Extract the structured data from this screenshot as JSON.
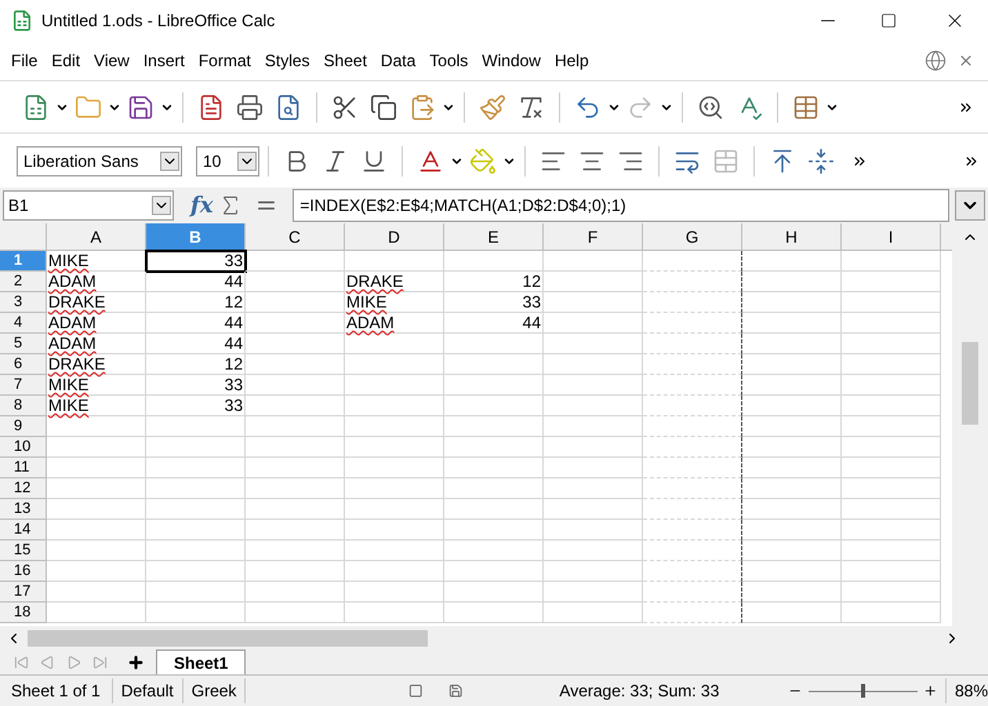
{
  "window": {
    "title": "Untitled 1.ods - LibreOffice Calc"
  },
  "menu": [
    "File",
    "Edit",
    "View",
    "Insert",
    "Format",
    "Styles",
    "Sheet",
    "Data",
    "Tools",
    "Window",
    "Help"
  ],
  "format_bar": {
    "font_name": "Liberation Sans",
    "font_size": "10"
  },
  "formula_bar": {
    "name_box": "B1",
    "function_wizard": "fx",
    "formula": "=INDEX(E$2:E$4;MATCH(A1;D$2:D$4;0);1)"
  },
  "columns": [
    {
      "label": "A",
      "selected": false
    },
    {
      "label": "B",
      "selected": true
    },
    {
      "label": "C",
      "selected": false
    },
    {
      "label": "D",
      "selected": false
    },
    {
      "label": "E",
      "selected": false
    },
    {
      "label": "F",
      "selected": false
    },
    {
      "label": "G",
      "selected": false
    },
    {
      "label": "H",
      "selected": false
    },
    {
      "label": "I",
      "selected": false
    }
  ],
  "rows": [
    {
      "number": "1",
      "selected": true,
      "cells": [
        {
          "text": "MIKE",
          "kind": "text",
          "misspelled": true
        },
        {
          "text": "33",
          "kind": "number",
          "selected": true
        },
        {},
        {},
        {},
        {},
        {},
        {},
        {}
      ]
    },
    {
      "number": "2",
      "selected": false,
      "cells": [
        {
          "text": "ADAM",
          "kind": "text",
          "misspelled": true
        },
        {
          "text": "44",
          "kind": "number"
        },
        {},
        {
          "text": "DRAKE",
          "kind": "text",
          "misspelled": true
        },
        {
          "text": "12",
          "kind": "number"
        },
        {},
        {},
        {},
        {}
      ]
    },
    {
      "number": "3",
      "selected": false,
      "cells": [
        {
          "text": "DRAKE",
          "kind": "text",
          "misspelled": true
        },
        {
          "text": "12",
          "kind": "number"
        },
        {},
        {
          "text": "MIKE",
          "kind": "text",
          "misspelled": true
        },
        {
          "text": "33",
          "kind": "number"
        },
        {},
        {},
        {},
        {}
      ]
    },
    {
      "number": "4",
      "selected": false,
      "cells": [
        {
          "text": "ADAM",
          "kind": "text",
          "misspelled": true
        },
        {
          "text": "44",
          "kind": "number"
        },
        {},
        {
          "text": "ADAM",
          "kind": "text",
          "misspelled": true
        },
        {
          "text": "44",
          "kind": "number"
        },
        {},
        {},
        {},
        {}
      ]
    },
    {
      "number": "5",
      "selected": false,
      "cells": [
        {
          "text": "ADAM",
          "kind": "text",
          "misspelled": true
        },
        {
          "text": "44",
          "kind": "number"
        },
        {},
        {},
        {},
        {},
        {},
        {},
        {}
      ]
    },
    {
      "number": "6",
      "selected": false,
      "cells": [
        {
          "text": "DRAKE",
          "kind": "text",
          "misspelled": true
        },
        {
          "text": "12",
          "kind": "number"
        },
        {},
        {},
        {},
        {},
        {},
        {},
        {}
      ]
    },
    {
      "number": "7",
      "selected": false,
      "cells": [
        {
          "text": "MIKE",
          "kind": "text",
          "misspelled": true
        },
        {
          "text": "33",
          "kind": "number"
        },
        {},
        {},
        {},
        {},
        {},
        {},
        {}
      ]
    },
    {
      "number": "8",
      "selected": false,
      "cells": [
        {
          "text": "MIKE",
          "kind": "text",
          "misspelled": true
        },
        {
          "text": "33",
          "kind": "number"
        },
        {},
        {},
        {},
        {},
        {},
        {},
        {}
      ]
    },
    {
      "number": "9",
      "selected": false
    },
    {
      "number": "10",
      "selected": false
    },
    {
      "number": "11",
      "selected": false
    },
    {
      "number": "12",
      "selected": false
    },
    {
      "number": "13",
      "selected": false
    },
    {
      "number": "14",
      "selected": false
    },
    {
      "number": "15",
      "selected": false
    },
    {
      "number": "16",
      "selected": false
    },
    {
      "number": "17",
      "selected": false
    },
    {
      "number": "18",
      "selected": false
    }
  ],
  "sheet_tabs": [
    {
      "label": "Sheet1",
      "selected": true
    }
  ],
  "status_bar": {
    "sheet": "Sheet 1 of 1",
    "page_style": "Default",
    "language": "Greek",
    "summary": "Average: 33; Sum: 33",
    "zoom": {
      "level": 0.5,
      "reading": "88%"
    }
  }
}
